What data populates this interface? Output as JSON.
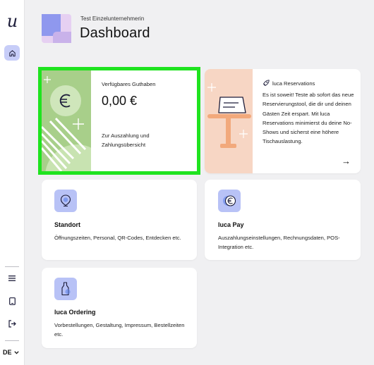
{
  "sidebar": {
    "logo": "u",
    "language": "DE"
  },
  "header": {
    "company": "Test Einzelunternehmerin",
    "title": "Dashboard"
  },
  "balance_card": {
    "label": "Verfügbares Guthaben",
    "amount": "0,00 €",
    "link": "Zur Auszahlung und Zahlungsübersicht",
    "highlight_color": "#1fe31f"
  },
  "reservations_card": {
    "title": "luca Reservations",
    "text": "Es ist soweit! Teste ab sofort das neue Reservierungstool, die dir und deinen Gästen Zeit erspart. Mit luca Reservations minimierst du deine No-Shows und sicherst eine höhere Tischauslastung.",
    "arrow": "→"
  },
  "cards": [
    {
      "title": "Standort",
      "description": "Öffnungszeiten, Personal, QR-Codes, Entdecken etc.",
      "icon": "location-pin-icon"
    },
    {
      "title": "luca Pay",
      "description": "Auszahlungseinstellungen, Rechnungsdaten, POS-Integration etc.",
      "icon": "euro-coin-icon"
    },
    {
      "title": "luca Ordering",
      "description": "Vorbestellungen, Gestaltung, Impressum, Bestellzeiten etc.",
      "icon": "bottle-icon"
    }
  ],
  "colors": {
    "accent": "#b8c2f6",
    "balance_art": "#a8cf8a",
    "reservation_art": "#f7d6c4"
  }
}
